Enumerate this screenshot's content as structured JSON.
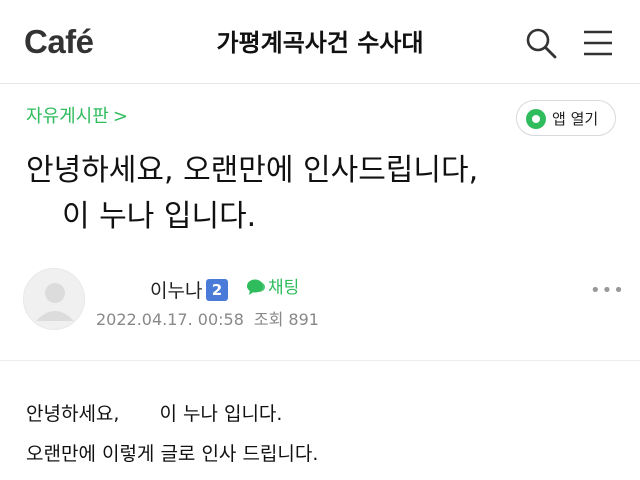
{
  "header": {
    "logo": "Café",
    "cafe_name": "가평계곡사건 수사대",
    "search_icon": "search-icon",
    "menu_icon": "hamburger-menu-icon"
  },
  "board": {
    "name": "자유게시판",
    "chevron": ">"
  },
  "app_button": {
    "label": "앱 열기",
    "icon": "naver-cafe-app-icon"
  },
  "post": {
    "title_line1": "안녕하세요, 오랜만에 인사드립니다,",
    "title_line2": "이 누나 입니다.",
    "author": "이누나",
    "grade": "2",
    "chat_label": "채팅",
    "date": "2022.04.17. 00:58",
    "views": "조회 891",
    "more": "•••",
    "body_line1_a": "안녕하세요,",
    "body_line1_b": "이 누나 입니다.",
    "body_line2": "오랜만에 이렇게 글로 인사 드립니다."
  },
  "colors": {
    "accent_green": "#2fbc5d",
    "grade_blue": "#4a7bd8"
  }
}
